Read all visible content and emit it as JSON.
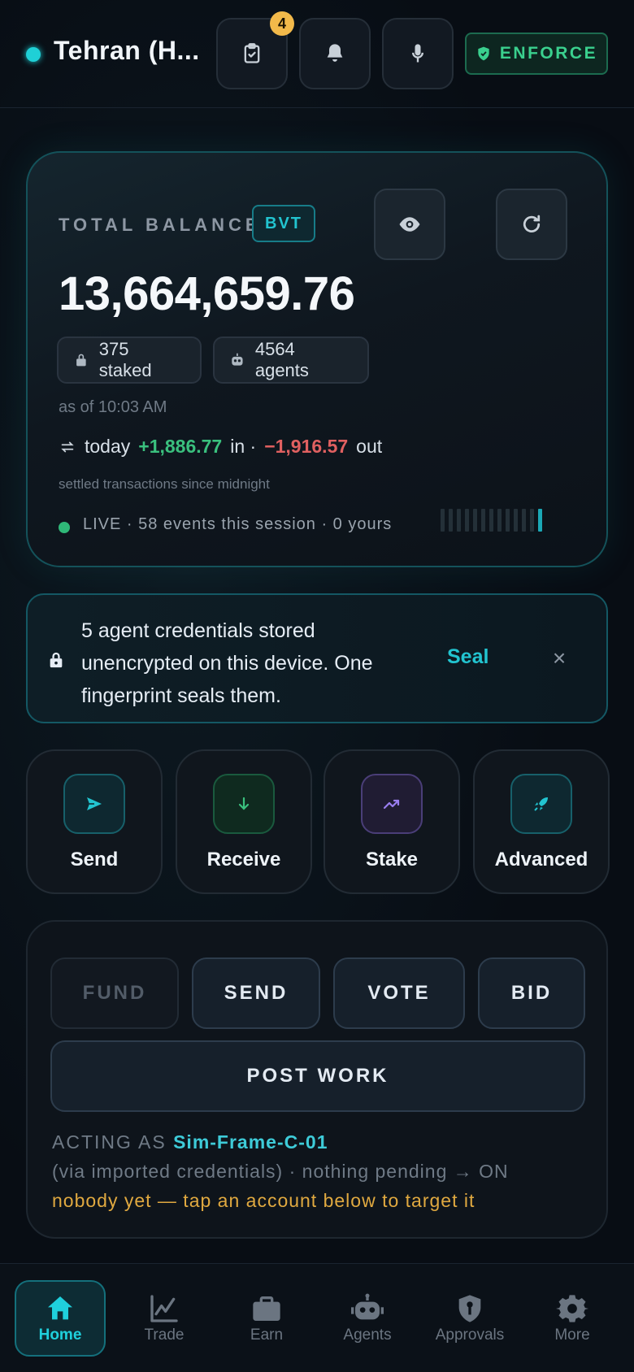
{
  "header": {
    "title": "Tehran (H...",
    "tasks_badge": "4",
    "tasks_icon": "clipboard-check-icon",
    "notifications_icon": "bell-icon",
    "voice_icon": "microphone-icon",
    "enforce_label": "ENFORCE"
  },
  "balance": {
    "label": "TOTAL BALANCE",
    "currency": "BVT",
    "amount": "13,664,659.76",
    "staked": "375 staked",
    "agents": "4564 agents",
    "as_of": "as of 10:03 AM",
    "today_prefix": "today",
    "in_amount": "+1,886.77",
    "in_label": "in ·",
    "out_amount": "−1,916.57",
    "out_label": "out",
    "settled_note": "settled transactions since midnight",
    "live_text": "LIVE · 58 events this session · 0 yours",
    "spark_active_count": 1,
    "spark_total": 13
  },
  "banner": {
    "message": "5 agent credentials stored unencrypted on this device. One fingerprint seals them.",
    "action": "Seal",
    "close": "×"
  },
  "quick_actions": [
    {
      "label": "Send",
      "icon": "send-icon",
      "color": "#22c4d0"
    },
    {
      "label": "Receive",
      "icon": "arrow-down-icon",
      "color": "#3ac07e"
    },
    {
      "label": "Stake",
      "icon": "trending-up-icon",
      "color": "#9a7ef0"
    },
    {
      "label": "Advanced",
      "icon": "rocket-icon",
      "color": "#22c4d0"
    }
  ],
  "panel": {
    "fund": "FUND",
    "send": "SEND",
    "vote": "VOTE",
    "bid": "BID",
    "post_work": "POST WORK",
    "acting_as_label": "ACTING AS",
    "acting_as_name": "Sim-Frame-C-01",
    "via_line": "(via imported credentials) · nothing pending → ON",
    "target_line": "nobody yet — tap an account below to target it"
  },
  "nav": [
    {
      "label": "Home",
      "icon": "home-icon",
      "active": true
    },
    {
      "label": "Trade",
      "icon": "chart-line-icon",
      "active": false
    },
    {
      "label": "Earn",
      "icon": "briefcase-icon",
      "active": false
    },
    {
      "label": "Agents",
      "icon": "robot-icon",
      "active": false
    },
    {
      "label": "Approvals",
      "icon": "shield-key-icon",
      "active": false
    },
    {
      "label": "More",
      "icon": "gear-icon",
      "active": false
    }
  ]
}
